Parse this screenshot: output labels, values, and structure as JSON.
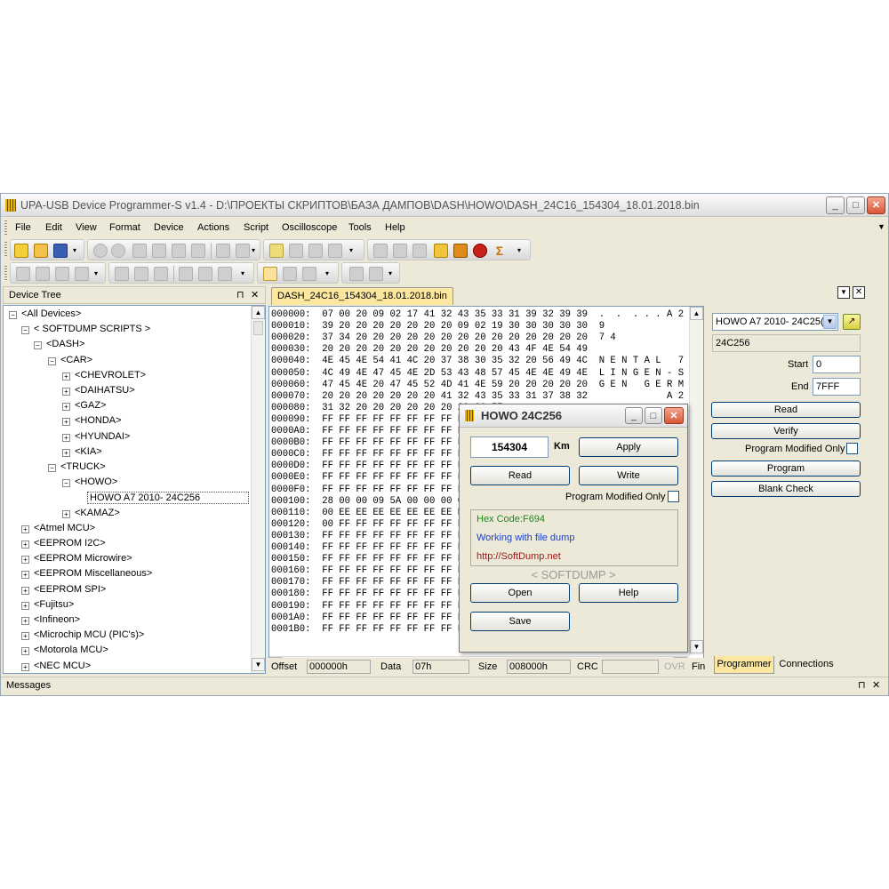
{
  "window": {
    "title": "UPA-USB Device Programmer-S v1.4 - D:\\ПРОЕКТЫ СКРИПТОВ\\БАЗА ДАМПОВ\\DASH\\HOWO\\DASH_24C16_154304_18.01.2018.bin",
    "minimize": "_",
    "maximize": "□",
    "close": "✕"
  },
  "menu": [
    "File",
    "Edit",
    "View",
    "Format",
    "Device",
    "Actions",
    "Script",
    "Oscilloscope",
    "Tools",
    "Help"
  ],
  "device_tree": {
    "header": "Device Tree",
    "pin": "⊓",
    "close": "✕",
    "nodes": [
      {
        "label": "<All Devices>",
        "sign": "-"
      },
      {
        "label": "< SOFTDUMP SCRIPTS >",
        "sign": "-"
      },
      {
        "label": "<DASH>",
        "sign": "-"
      },
      {
        "label": "<CAR>",
        "sign": "-"
      },
      {
        "label": "<CHEVROLET>",
        "sign": "+"
      },
      {
        "label": "<DAIHATSU>",
        "sign": "+"
      },
      {
        "label": "<GAZ>",
        "sign": "+"
      },
      {
        "label": "<HONDA>",
        "sign": "+"
      },
      {
        "label": "<HYUNDAI>",
        "sign": "+"
      },
      {
        "label": "<KIA>",
        "sign": "+"
      },
      {
        "label": "<TRUCK>",
        "sign": "-"
      },
      {
        "label": "<HOWO>",
        "sign": "-"
      },
      {
        "label": "HOWO A7 2010- 24C256",
        "sign": ""
      },
      {
        "label": "<KAMAZ>",
        "sign": "+"
      },
      {
        "label": "<Atmel MCU>",
        "sign": "+"
      },
      {
        "label": "<EEPROM I2C>",
        "sign": "+"
      },
      {
        "label": "<EEPROM Microwire>",
        "sign": "+"
      },
      {
        "label": "<EEPROM Miscellaneous>",
        "sign": "+"
      },
      {
        "label": "<EEPROM SPI>",
        "sign": "+"
      },
      {
        "label": "<Fujitsu>",
        "sign": "+"
      },
      {
        "label": "<Infineon>",
        "sign": "+"
      },
      {
        "label": "<Microchip MCU (PIC's)>",
        "sign": "+"
      },
      {
        "label": "<Motorola MCU>",
        "sign": "+"
      },
      {
        "label": "<NEC MCU>",
        "sign": "+"
      }
    ]
  },
  "editor": {
    "tab": "DASH_24C16_154304_18.01.2018.bin",
    "hex_rows": [
      "000000:  07 00 20 09 02 17 41 32 43 35 33 31 39 32 39 39  .  .  . . . A 2 C 5 3 1",
      "000010:  39 20 20 20 20 20 20 20 09 02 19 30 30 30 30 30  9               . . . (",
      "000020:  37 34 20 20 20 20 20 20 20 20 20 20 20 20 20 20  7 4",
      "000030:  20 20 20 20 20 20 20 20 20 20 20 43 4F 4E 54 49                       (",
      "000040:  4E 45 4E 54 41 4C 20 37 38 30 35 32 20 56 49 4C  N E N T A L   7 8 0 5 2",
      "000050:  4C 49 4E 47 45 4E 2D 53 43 48 57 45 4E 4E 49 4E  L I N G E N - S C H W E",
      "000060:  47 45 4E 20 47 45 52 4D 41 4E 59 20 20 20 20 20  G E N   G E R M A N Y",
      "000070:  20 20 20 20 20 20 20 41 32 43 35 33 31 37 38 32              A 2 C 5 3",
      "000080:  31 32 20 20 20 20 20 20 20 20 FF",
      "000090:  FF FF FF FF FF FF FF FF FF FF FF",
      "0000A0:  FF FF FF FF FF FF FF FF FF FF FF",
      "0000B0:  FF FF FF FF FF FF FF FF FF FF FF",
      "0000C0:  FF FF FF FF FF FF FF FF FF FF FF",
      "0000D0:  FF FF FF FF FF FF FF FF FF FF FF",
      "0000E0:  FF FF FF FF FF FF FF FF FF FF FF",
      "0000F0:  FF FF FF FF FF FF FF FF FF FF FF",
      "000100:  28 00 00 09 5A 00 00 00 01",
      "000110:  00 EE EE EE EE EE EE EE EE",
      "000120:  00 FF FF FF FF FF FF FF FF",
      "000130:  FF FF FF FF FF FF FF FF FF",
      "000140:  FF FF FF FF FF FF FF FF FF",
      "000150:  FF FF FF FF FF FF FF FF FF",
      "000160:  FF FF FF FF FF FF FF FF FF",
      "000170:  FF FF FF FF FF FF FF FF FF",
      "000180:  FF FF FF FF FF FF FF FF FF",
      "000190:  FF FF FF FF FF FF FF FF FF",
      "0001A0:  FF FF FF FF FF FF FF FF FF",
      "0001B0:  FF FF FF FF FF FF FF FF FF"
    ],
    "status": {
      "offset_label": "Offset",
      "offset_value": "000000h",
      "data_label": "Data",
      "data_value": "07h",
      "size_label": "Size",
      "size_value": "008000h",
      "crc_label": "CRC",
      "crc_value": "",
      "ovr_label": "OVR",
      "find_label": "Fin"
    }
  },
  "programmer_panel": {
    "device_select": "HOWO A7 2010- 24C25(",
    "chip": "24C256",
    "start_label": "Start",
    "start_value": "0",
    "end_label": "End",
    "end_value": "7FFF",
    "read": "Read",
    "verify": "Verify",
    "program_modified_only": "Program Modified Only",
    "program": "Program",
    "blank_check": "Blank Check",
    "tabs": [
      "Programmer",
      "Connections"
    ]
  },
  "dialog": {
    "title": "HOWO 24C256",
    "km_value": "154304",
    "km_unit": "Km",
    "apply": "Apply",
    "read": "Read",
    "write": "Write",
    "program_modified_only": "Program Modified Only",
    "hex_code": "Hex Code:F694",
    "status": "Working with file dump",
    "url": "http://SoftDump.net",
    "brand": "< SOFTDUMP >",
    "open": "Open",
    "help": "Help",
    "save": "Save",
    "colors": {
      "hex_code": "#1a8a1a",
      "status": "#1a3fcf",
      "url": "#a01818"
    }
  },
  "messages": {
    "label": "Messages",
    "pin": "⊓",
    "close": "✕"
  }
}
